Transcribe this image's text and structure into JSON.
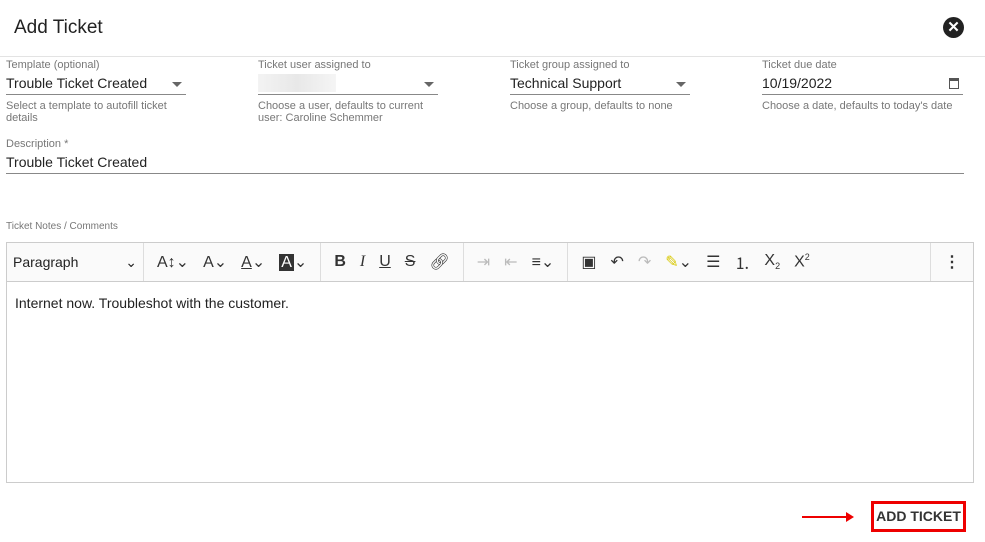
{
  "dialog": {
    "title": "Add Ticket",
    "close_icon": "close-circle-icon"
  },
  "fields": {
    "template": {
      "label": "Template (optional)",
      "value": "Trouble Ticket Created",
      "hint": "Select a template to autofill ticket details"
    },
    "user": {
      "label": "Ticket user assigned to",
      "value": "",
      "hint": "Choose a user, defaults to current user: Caroline Schemmer"
    },
    "group": {
      "label": "Ticket group assigned to",
      "value": "Technical Support",
      "hint": "Choose a group, defaults to none"
    },
    "due": {
      "label": "Ticket due date",
      "value": "10/19/2022",
      "hint": "Choose a date, defaults to today's date"
    },
    "description": {
      "label": "Description *",
      "value": "Trouble Ticket Created"
    }
  },
  "editor": {
    "label": "Ticket Notes / Comments",
    "paragraph": "Paragraph",
    "content": "Internet now. Troubleshot with the customer."
  },
  "actions": {
    "add": "ADD TICKET"
  },
  "colors": {
    "highlight": "#e00000"
  }
}
